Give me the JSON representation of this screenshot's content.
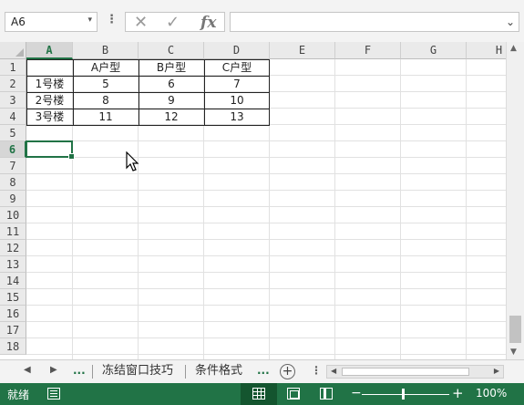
{
  "formula_bar": {
    "name_box": "A6",
    "name_box_dropdown": "▾",
    "more_dots": "⋮",
    "cancel_glyph": "✕",
    "enter_glyph": "✓",
    "fx_label": "fx",
    "formula_value": "",
    "expand_glyph": "⌄"
  },
  "grid": {
    "columns": [
      "A",
      "B",
      "C",
      "D",
      "E",
      "F",
      "G",
      "H"
    ],
    "selected_column": "A",
    "rows": [
      "1",
      "2",
      "3",
      "4",
      "5",
      "6",
      "7",
      "8",
      "9",
      "10",
      "11",
      "12",
      "13",
      "14",
      "15",
      "16",
      "17",
      "18"
    ],
    "selected_row": "6",
    "active_cell": "A6",
    "cells": [
      [
        "",
        "A户型",
        "B户型",
        "C户型"
      ],
      [
        "1号楼",
        "5",
        "6",
        "7"
      ],
      [
        "2号楼",
        "8",
        "9",
        "10"
      ],
      [
        "3号楼",
        "11",
        "12",
        "13"
      ]
    ]
  },
  "sheet_tabs": {
    "prev": "◀",
    "next": "▶",
    "ellipsis_left": "...",
    "tabs": [
      "冻结窗口技巧",
      "条件格式"
    ],
    "ellipsis_right": "...",
    "add": "+",
    "options": "⋮"
  },
  "status_bar": {
    "ready_text": "就绪",
    "zoom_minus": "−",
    "zoom_plus": "+",
    "zoom_percent": "100%",
    "zoom_level": 1.0
  },
  "colors": {
    "accent": "#217346",
    "status_bg": "#217346",
    "gridline": "#e1e1e1"
  },
  "icons": {
    "cursor": "mouse-pointer-icon",
    "macro": "macro-record-icon",
    "normal_view": "normal-view-icon",
    "page_layout_view": "page-layout-view-icon",
    "page_break_view": "page-break-preview-icon"
  }
}
